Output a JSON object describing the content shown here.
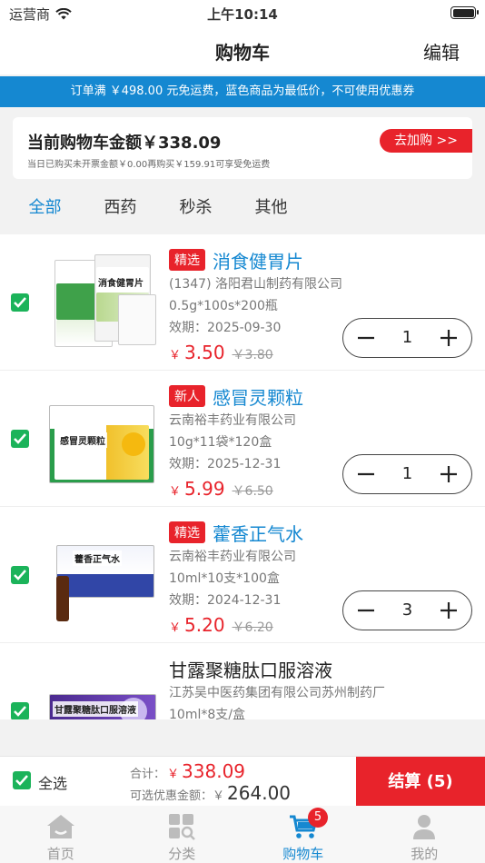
{
  "status_bar": {
    "carrier": "运营商",
    "time": "上午10:14"
  },
  "nav": {
    "title": "购物车",
    "edit_label": "编辑"
  },
  "promo_banner": "订单满 ￥498.00 元免运费，蓝色商品为最低价，不可使用优惠券",
  "amount_card": {
    "title": "当前购物车金额￥338.09",
    "sub": "当日已购买未开票金额￥0.00再购买￥159.91可享受免运费",
    "add_button": "去加购 >>"
  },
  "tabs": [
    {
      "label": "全部",
      "active": true
    },
    {
      "label": "西药",
      "active": false
    },
    {
      "label": "秒杀",
      "active": false
    },
    {
      "label": "其他",
      "active": false
    }
  ],
  "items": [
    {
      "tag": "精选",
      "name": "消食健胃片",
      "maker": "(1347) 洛阳君山制药有限公司",
      "spec": "0.5g*100s*200瓶",
      "expiry": "效期：2025-09-30",
      "yen": "￥",
      "price": "3.50",
      "old_price": "￥3.80",
      "qty": "1",
      "box_label": "消食健胃片"
    },
    {
      "tag": "新人",
      "name": "感冒灵颗粒",
      "maker": "云南裕丰药业有限公司",
      "spec": "10g*11袋*120盒",
      "expiry": "效期：2025-12-31",
      "yen": "￥",
      "price": "5.99",
      "old_price": "￥6.50",
      "qty": "1",
      "box_label": "感冒灵颗粒"
    },
    {
      "tag": "精选",
      "name": "藿香正气水",
      "maker": "云南裕丰药业有限公司",
      "spec": "10ml*10支*100盒",
      "expiry": "效期：2024-12-31",
      "yen": "￥",
      "price": "5.20",
      "old_price": "￥6.20",
      "qty": "3",
      "box_label": "藿香正气水"
    },
    {
      "tag": "",
      "name": "甘露聚糖肽口服溶液",
      "maker": "江苏吴中医药集团有限公司苏州制药厂",
      "spec": "10ml*8支/盒",
      "box_label": "甘露聚糖肽口服溶液"
    }
  ],
  "bottom": {
    "select_all": "全选",
    "total_label": "合计：",
    "total_yen": "￥",
    "total_value": "338.09",
    "discount_label": "可选优惠金额：",
    "discount_yen": "￥",
    "discount_value": "264.00",
    "checkout": "结算 (5)"
  },
  "tab_bar": [
    {
      "label": "首页",
      "icon": "home-icon",
      "active": false
    },
    {
      "label": "分类",
      "icon": "category-icon",
      "active": false
    },
    {
      "label": "购物车",
      "icon": "cart-icon",
      "active": true,
      "badge": "5"
    },
    {
      "label": "我的",
      "icon": "profile-icon",
      "active": false
    }
  ],
  "colors": {
    "accent": "#1588d1",
    "danger": "#e8232b",
    "check": "#1bb35a"
  }
}
